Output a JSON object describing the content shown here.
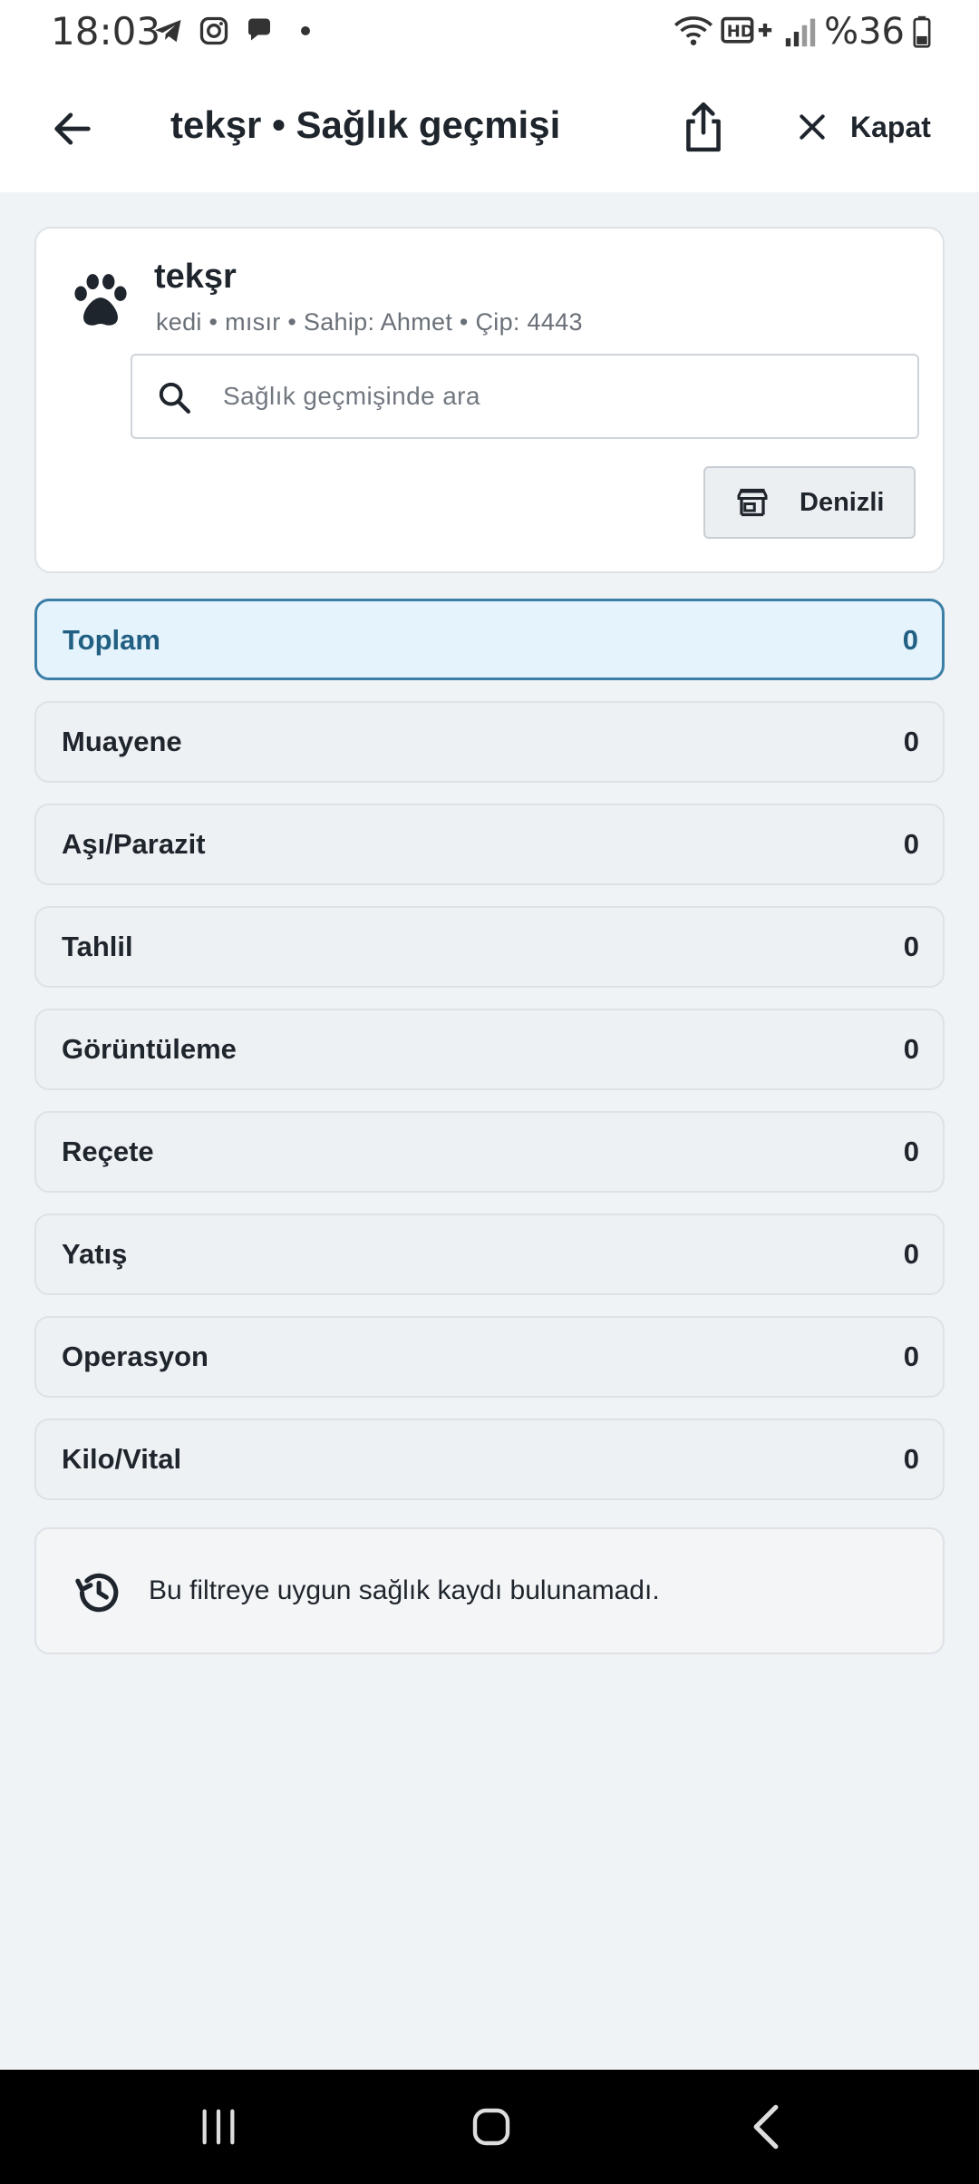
{
  "status_bar": {
    "time": "18:03",
    "battery": "%36",
    "network": "HD+"
  },
  "app_bar": {
    "title": "tekşr • Sağlık geçmişi",
    "close_label": "Kapat"
  },
  "pet": {
    "name": "tekşr",
    "meta": "kedi • mısır • Sahip: Ahmet • Çip: 4443"
  },
  "search": {
    "placeholder": "Sağlık geçmişinde ara",
    "value": ""
  },
  "store_button": {
    "label": "Denizli"
  },
  "filters": [
    {
      "label": "Toplam",
      "count": "0",
      "active": true
    },
    {
      "label": "Muayene",
      "count": "0",
      "active": false
    },
    {
      "label": "Aşı/Parazit",
      "count": "0",
      "active": false
    },
    {
      "label": "Tahlil",
      "count": "0",
      "active": false
    },
    {
      "label": "Görüntüleme",
      "count": "0",
      "active": false
    },
    {
      "label": "Reçete",
      "count": "0",
      "active": false
    },
    {
      "label": "Yatış",
      "count": "0",
      "active": false
    },
    {
      "label": "Operasyon",
      "count": "0",
      "active": false
    },
    {
      "label": "Kilo/Vital",
      "count": "0",
      "active": false
    }
  ],
  "empty_state": {
    "message": "Bu filtreye uygun sağlık kaydı bulunamadı."
  },
  "colors": {
    "accent": "#3b7ea6",
    "active_bg": "#e5f3fc",
    "page_bg": "#f0f3f6"
  }
}
